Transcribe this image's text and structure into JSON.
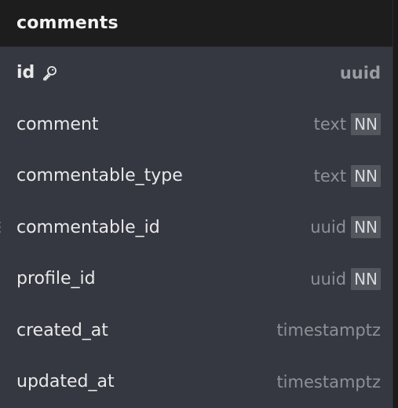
{
  "table": {
    "title": "comments",
    "columns": [
      {
        "name": "id",
        "type": "uuid",
        "primary_key": true,
        "nn": "",
        "icon": "key-icon"
      },
      {
        "name": "comment",
        "type": "text",
        "primary_key": false,
        "nn": "NN"
      },
      {
        "name": "commentable_type",
        "type": "text",
        "primary_key": false,
        "nn": "NN"
      },
      {
        "name": "commentable_id",
        "type": "uuid",
        "primary_key": false,
        "nn": "NN"
      },
      {
        "name": "profile_id",
        "type": "uuid",
        "primary_key": false,
        "nn": "NN"
      },
      {
        "name": "created_at",
        "type": "timestamptz",
        "primary_key": false,
        "nn": ""
      },
      {
        "name": "updated_at",
        "type": "timestamptz",
        "primary_key": false,
        "nn": ""
      }
    ]
  },
  "colors": {
    "header_bg": "#1d1d1d",
    "body_bg": "#363841",
    "badge_bg": "#55575f",
    "type_text": "#8e9097"
  }
}
